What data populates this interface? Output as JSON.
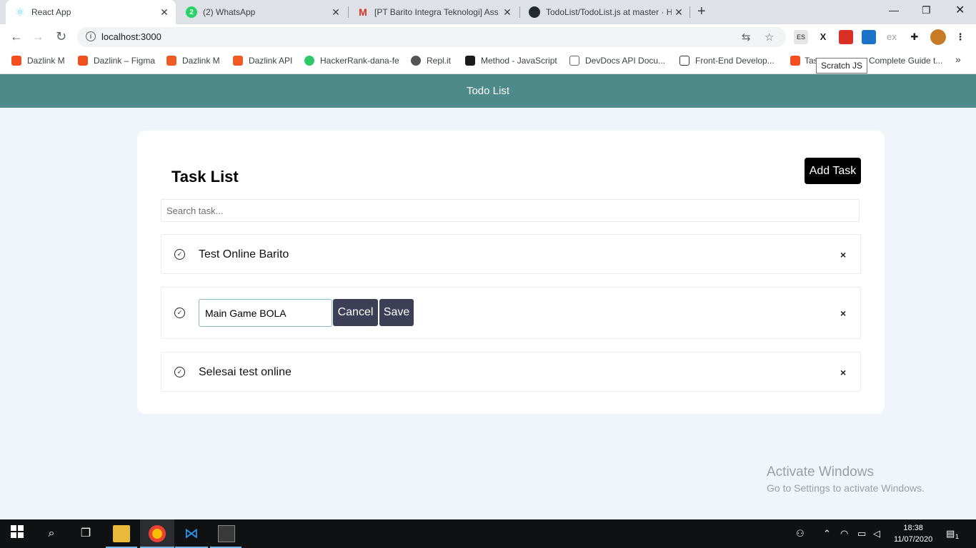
{
  "browser": {
    "tabs": [
      {
        "title": "React App",
        "icon": "react-icon",
        "active": true
      },
      {
        "title": "(2) WhatsApp",
        "icon": "whatsapp-icon",
        "badge": "2"
      },
      {
        "title": "[PT Barito Integra Teknologi] Ass",
        "icon": "gmail-icon"
      },
      {
        "title": "TodoList/TodoList.js at master · H",
        "icon": "github-icon"
      }
    ],
    "new_tab": "+",
    "url": "localhost:3000",
    "bookmarks": [
      "Dazlink M",
      "Dazlink – Figma",
      "Dazlink M",
      "Dazlink API",
      "HackerRank-dana-fe",
      "Repl.it",
      "Method - JavaScript",
      "DevDocs API Docu...",
      "Front-End Develop...",
      "Tas",
      "Complete Guide t..."
    ],
    "bookmarks_more": "»",
    "tooltip": "Scratch JS",
    "extensions": [
      "ES",
      "X",
      "ex"
    ]
  },
  "app": {
    "header_title": "Todo List",
    "card_title": "Task List",
    "add_button": "Add Task",
    "search_placeholder": "Search task...",
    "tasks": [
      {
        "text": "Test Online Barito",
        "editing": false
      },
      {
        "text": "Main Game BOLA",
        "editing": true
      },
      {
        "text": "Selesai test online",
        "editing": false
      }
    ],
    "cancel_label": "Cancel",
    "save_label": "Save",
    "delete_glyph": "×"
  },
  "watermark": {
    "line1": "Activate Windows",
    "line2": "Go to Settings to activate Windows."
  },
  "taskbar": {
    "time": "18:38",
    "date": "11/07/2020",
    "notification_count": "1"
  },
  "colors": {
    "appbar": "#4f8a8b",
    "page_bg": "#f0f4fb",
    "dark_button": "#3d3f57"
  }
}
